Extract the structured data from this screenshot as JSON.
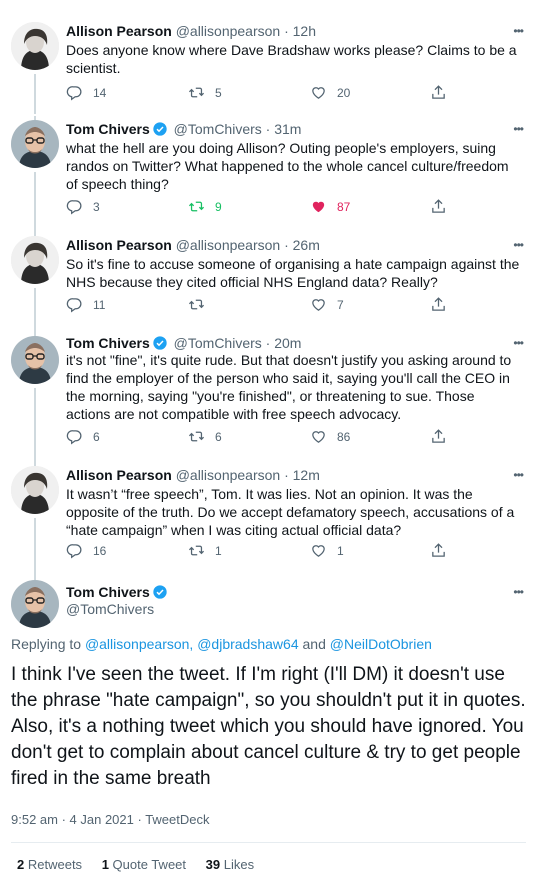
{
  "tweets": [
    {
      "name": "Allison Pearson",
      "handle": "@allisonpearson",
      "time": "· 12h",
      "text": "Does anyone know where Dave Bradshaw works please? Claims to be a scientist.",
      "replies": "14",
      "retweets": "5",
      "likes": "20"
    },
    {
      "name": "Tom Chivers",
      "handle": "@TomChivers",
      "time": "· 31m",
      "text": "what the hell are you doing Allison? Outing people's employers, suing randos on Twitter? What happened to the whole cancel culture/freedom of speech thing?",
      "replies": "3",
      "retweets": "9",
      "likes": "87"
    },
    {
      "name": "Allison Pearson",
      "handle": "@allisonpearson",
      "time": "· 26m",
      "text": "So it's fine to accuse someone of organising a hate campaign against the NHS because they cited official NHS England data?  Really?",
      "replies": "11",
      "retweets": "",
      "likes": "7"
    },
    {
      "name": "Tom Chivers",
      "handle": "@TomChivers",
      "time": "· 20m",
      "text": "it's not \"fine\", it's quite rude. But that doesn't justify you asking around to find the employer of the person who said it, saying you'll call the CEO in the morning, saying \"you're finished\", or threatening to sue. Those actions are not compatible with free speech advocacy.",
      "replies": "6",
      "retweets": "6",
      "likes": "86"
    },
    {
      "name": "Allison Pearson",
      "handle": "@allisonpearson",
      "time": "· 12m",
      "text": "It wasn’t “free speech”, Tom. It was lies. Not an opinion. It was the opposite of the truth. Do we accept defamatory speech, accusations of a “hate campaign” when I was citing actual official data?",
      "replies": "16",
      "retweets": "1",
      "likes": "1"
    }
  ],
  "main_tweet": {
    "name": "Tom Chivers",
    "handle": "@TomChivers",
    "replying_prefix": "Replying to",
    "reply_to_1": "@allisonpearson,",
    "reply_to_2": "@djbradshaw64",
    "reply_and": "and",
    "reply_to_3": "@NeilDotObrien",
    "text": "I think I've seen the tweet. If I'm right (I'll DM) it doesn't use the phrase \"hate campaign\", so you shouldn't put it in quotes. Also, it's a nothing tweet which you should have ignored. You don't get to complain about cancel culture & try to get people fired in the same breath",
    "timestamp": "9:52 am · 4 Jan 2021 · ",
    "source": "TweetDeck",
    "retweets_count": "2",
    "retweets_label": "Retweets",
    "quotes_count": "1",
    "quotes_label": "Quote Tweet",
    "likes_count": "39",
    "likes_label": "Likes"
  },
  "more_icon": "•••",
  "colors": {
    "link": "#1b95e0",
    "verified": "#1da1f2",
    "retweet_active": "#17bf63",
    "like_active": "#e0245e",
    "secondary": "#536471"
  }
}
